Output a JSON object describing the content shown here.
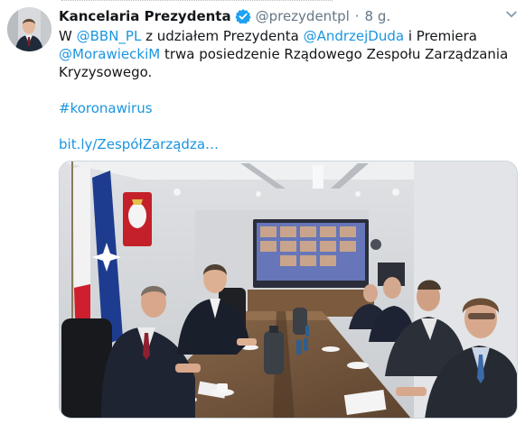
{
  "tweet": {
    "display_name": "Kancelaria Prezydenta",
    "handle": "@prezydentpl",
    "separator": "·",
    "timestamp": "8 g.",
    "verified_color": "#1da1f2",
    "link_color": "#1b95e0",
    "text": {
      "t1": "W ",
      "mention_bbn": "@BBN_PL",
      "t2": " z udziałem Prezydenta ",
      "mention_duda": "@AndrzejDuda",
      "t3": " i Premiera",
      "mention_morawiecki": "@MorawieckiM",
      "t4": " trwa posiedzenie Rządowego Zespołu Zarządzania",
      "t5": "Kryzysowego.",
      "hashtag": "#koronawirus",
      "link": "bit.ly/ZespółZarządza…"
    },
    "media": {
      "icon": "photo",
      "flag_left": "Poland",
      "flag_right": "NATO"
    },
    "icons": {
      "avatar": "profile-photo",
      "verified": "verified-badge-icon",
      "caret": "chevron-down-icon"
    }
  }
}
